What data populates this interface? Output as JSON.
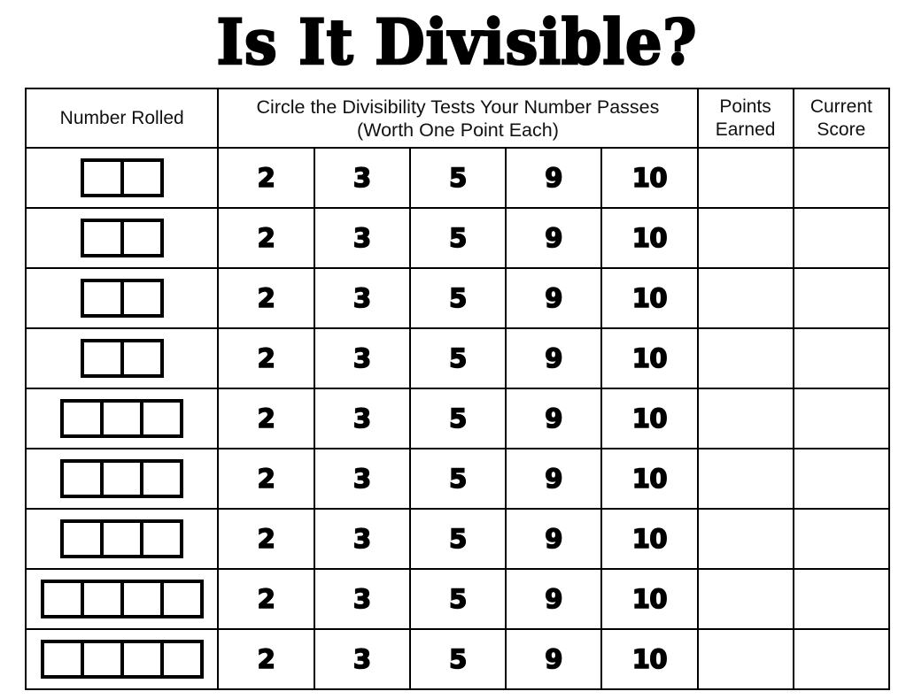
{
  "title": "Is It Divisible?",
  "table": {
    "headers": {
      "number_rolled": "Number Rolled",
      "tests_line1": "Circle the Divisibility Tests Your Number Passes",
      "tests_line2": "(Worth One Point Each)",
      "points_earned_line1": "Points",
      "points_earned_line2": "Earned",
      "current_score_line1": "Current",
      "current_score_line2": "Score"
    },
    "divisibility_tests": [
      "2",
      "3",
      "5",
      "9",
      "10"
    ],
    "rows": [
      {
        "digit_count": 2,
        "tests": [
          "2",
          "3",
          "5",
          "9",
          "10"
        ],
        "points_earned": "",
        "current_score": ""
      },
      {
        "digit_count": 2,
        "tests": [
          "2",
          "3",
          "5",
          "9",
          "10"
        ],
        "points_earned": "",
        "current_score": ""
      },
      {
        "digit_count": 2,
        "tests": [
          "2",
          "3",
          "5",
          "9",
          "10"
        ],
        "points_earned": "",
        "current_score": ""
      },
      {
        "digit_count": 2,
        "tests": [
          "2",
          "3",
          "5",
          "9",
          "10"
        ],
        "points_earned": "",
        "current_score": ""
      },
      {
        "digit_count": 3,
        "tests": [
          "2",
          "3",
          "5",
          "9",
          "10"
        ],
        "points_earned": "",
        "current_score": ""
      },
      {
        "digit_count": 3,
        "tests": [
          "2",
          "3",
          "5",
          "9",
          "10"
        ],
        "points_earned": "",
        "current_score": ""
      },
      {
        "digit_count": 3,
        "tests": [
          "2",
          "3",
          "5",
          "9",
          "10"
        ],
        "points_earned": "",
        "current_score": ""
      },
      {
        "digit_count": 4,
        "tests": [
          "2",
          "3",
          "5",
          "9",
          "10"
        ],
        "points_earned": "",
        "current_score": ""
      },
      {
        "digit_count": 4,
        "tests": [
          "2",
          "3",
          "5",
          "9",
          "10"
        ],
        "points_earned": "",
        "current_score": ""
      }
    ]
  },
  "colors": {
    "ink": "#000000",
    "paper": "#ffffff",
    "grid": "#000000"
  }
}
